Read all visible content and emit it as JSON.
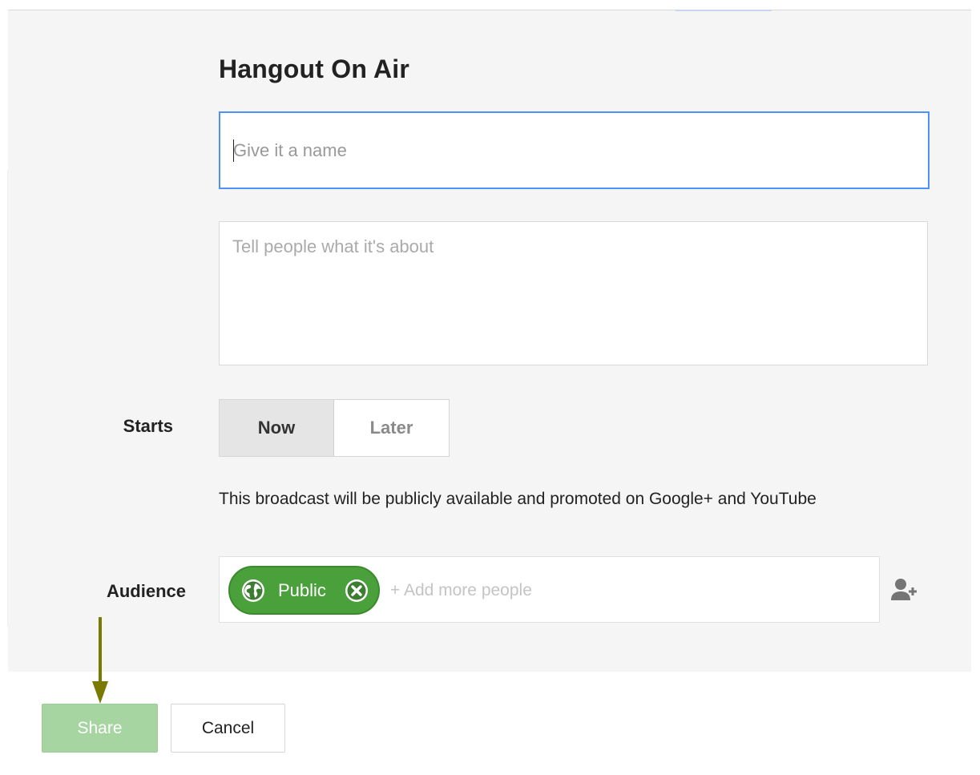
{
  "dialog": {
    "title": "Hangout On Air"
  },
  "name_field": {
    "value": "",
    "placeholder": "Give it a name"
  },
  "description_field": {
    "value": "",
    "placeholder": "Tell people what it's about"
  },
  "starts": {
    "label": "Starts",
    "options": [
      "Now",
      "Later"
    ],
    "selected": "Now"
  },
  "notice": "This broadcast will be publicly available and promoted on Google+ and YouTube",
  "audience": {
    "label": "Audience",
    "chips": [
      {
        "label": "Public",
        "icon": "globe-icon",
        "remove_icon": "remove-chip-icon"
      }
    ],
    "add_placeholder": "+ Add more people",
    "add_person_icon": "add-person-icon"
  },
  "footer": {
    "share_label": "Share",
    "cancel_label": "Cancel"
  },
  "colors": {
    "focus_border": "#4d90fe",
    "chip_green": "#4aa03a",
    "share_disabled_green": "#a6d5a2",
    "annotation_arrow": "#7a7a00"
  }
}
